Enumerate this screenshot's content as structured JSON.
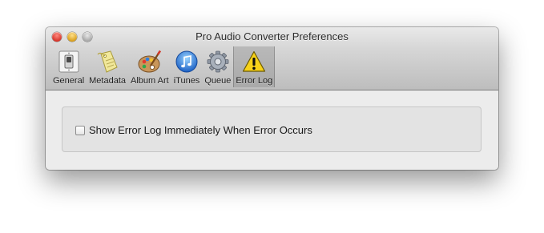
{
  "window": {
    "title": "Pro Audio Converter Preferences"
  },
  "toolbar": {
    "items": [
      {
        "label": "General",
        "icon": "light-switch-icon"
      },
      {
        "label": "Metadata",
        "icon": "tag-icon"
      },
      {
        "label": "Album Art",
        "icon": "palette-icon"
      },
      {
        "label": "iTunes",
        "icon": "itunes-icon"
      },
      {
        "label": "Queue",
        "icon": "gear-icon"
      },
      {
        "label": "Error Log",
        "icon": "warning-icon",
        "selected": true
      }
    ]
  },
  "content": {
    "checkbox": {
      "label": "Show Error Log Immediately When Error Occurs",
      "checked": false
    }
  }
}
